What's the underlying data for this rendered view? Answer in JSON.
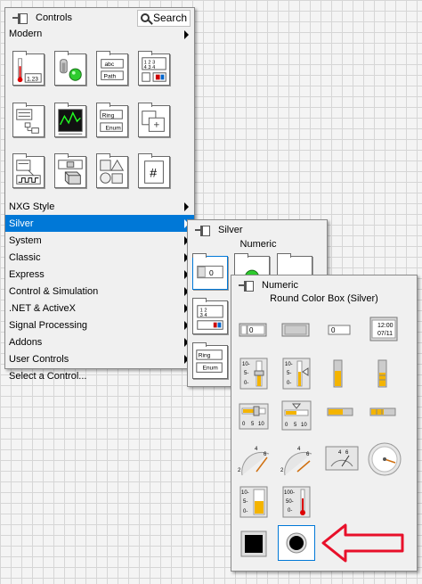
{
  "controls_palette": {
    "title": "Controls",
    "search_label": "Search",
    "modern_label": "Modern",
    "categories": [
      {
        "label": "NXG Style"
      },
      {
        "label": "Silver"
      },
      {
        "label": "System"
      },
      {
        "label": "Classic"
      },
      {
        "label": "Express"
      },
      {
        "label": "Control & Simulation"
      },
      {
        "label": ".NET & ActiveX"
      },
      {
        "label": "Signal Processing"
      },
      {
        "label": "Addons"
      },
      {
        "label": "User Controls"
      },
      {
        "label": "Select a Control..."
      }
    ],
    "selected_category": "Silver",
    "modern_icons": [
      "numeric-thermometer-icon",
      "boolean-toggle-led-icon",
      "string-path-icon",
      "array-matrix-cluster-icon",
      "list-table-tree-icon",
      "graph-icon",
      "ring-enum-icon",
      "containers-icon",
      "io-waveform-icon",
      "variant-class-icon",
      "decorations-icon",
      "refnum-icon"
    ],
    "modern_icon_texts": {
      "numeric": "1.23",
      "string_top": "abc",
      "string_bottom": "Path",
      "ring": "Ring",
      "enum": "Enum",
      "refnum": "#"
    }
  },
  "silver_palette": {
    "title": "Silver",
    "subtitle": "Numeric",
    "icon_texts": {
      "numeric_value": "0",
      "ring": "Ring",
      "enum": "Enum"
    }
  },
  "numeric_palette": {
    "title": "Numeric",
    "hover_label": "Round Color Box (Silver)",
    "timestamp": [
      "12:00",
      "07/11"
    ],
    "numeric_values": [
      "0",
      "0"
    ],
    "slider_ticks": [
      "10-",
      "5-",
      "0-"
    ],
    "hslider_ticks": [
      "0",
      "5",
      "10"
    ],
    "knob_ticks": [
      "2",
      "4",
      "6",
      "8",
      "10"
    ],
    "meter_ticks": [
      "4",
      "6",
      "2",
      "8",
      "10"
    ],
    "tank_ticks": [
      "10-",
      "5-",
      "0-"
    ],
    "thermo_ticks": [
      "100-",
      "50-",
      "0-"
    ]
  },
  "accent_colors": {
    "selection": "#0078d7",
    "arrow": "#e8102a",
    "fill": "#f4b400"
  }
}
